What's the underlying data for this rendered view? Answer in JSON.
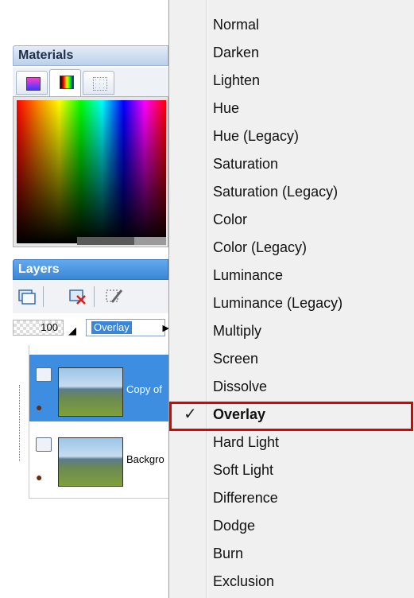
{
  "materials": {
    "title": "Materials"
  },
  "layers": {
    "title": "Layers",
    "opacity": "100",
    "blend_mode_value": "Overlay",
    "items": [
      {
        "name": "Copy of",
        "selected": true
      },
      {
        "name": "Backgro",
        "selected": false
      }
    ]
  },
  "blend_menu": {
    "items": [
      {
        "label": "Normal"
      },
      {
        "label": "Darken"
      },
      {
        "label": "Lighten"
      },
      {
        "label": "Hue"
      },
      {
        "label": "Hue (Legacy)"
      },
      {
        "label": "Saturation"
      },
      {
        "label": "Saturation (Legacy)"
      },
      {
        "label": "Color"
      },
      {
        "label": "Color (Legacy)"
      },
      {
        "label": "Luminance"
      },
      {
        "label": "Luminance (Legacy)"
      },
      {
        "label": "Multiply"
      },
      {
        "label": "Screen"
      },
      {
        "label": "Dissolve"
      },
      {
        "label": "Overlay",
        "checked": true
      },
      {
        "label": "Hard Light"
      },
      {
        "label": "Soft Light"
      },
      {
        "label": "Difference"
      },
      {
        "label": "Dodge"
      },
      {
        "label": "Burn"
      },
      {
        "label": "Exclusion"
      }
    ],
    "check_glyph": "✓",
    "highlight_color": "#e00000"
  }
}
